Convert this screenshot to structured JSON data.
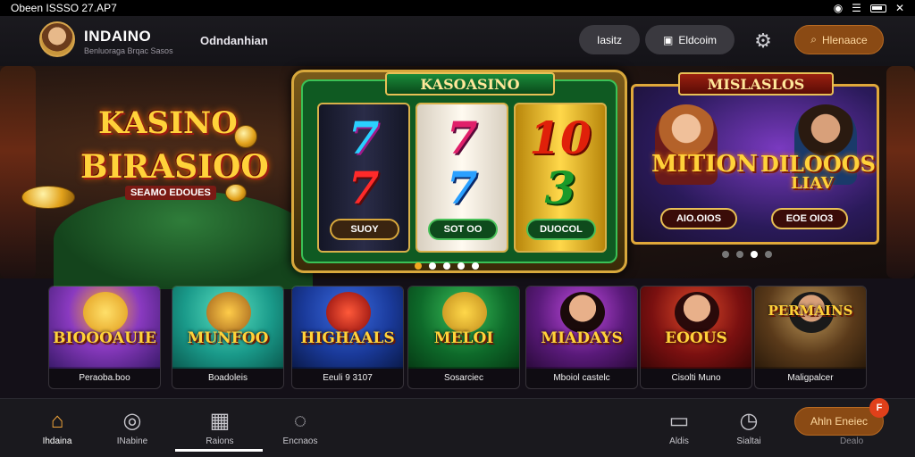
{
  "status_bar": {
    "time": "Obeen ISSSO 27.AP7"
  },
  "header": {
    "brand_title": "INDAINO",
    "brand_subtitle": "Benluoraga Brqac Sasos",
    "nav_link": "Odndanhian",
    "login_label": "Iasitz",
    "register_label": "Eldcoim",
    "search_label": "Hlenaace"
  },
  "banner": {
    "left_promo": {
      "line1": "KASINO",
      "line2": "BIRASIOO",
      "tag": "SEAMO EDOUES"
    },
    "slot": {
      "header": "KASOASINO",
      "reels": [
        {
          "top": "7",
          "bottom": "7",
          "button": "SUOY"
        },
        {
          "top": "7",
          "bottom": "7",
          "button": "SOT OO"
        },
        {
          "top": "10",
          "bottom": "3",
          "button": "DUOCOL"
        }
      ]
    },
    "right_promo": {
      "header": "MISLASLOS",
      "word1": "MITION",
      "word2": "DILOOOS",
      "word3": "LIAV",
      "button1": "AIO.OIOS",
      "button2": "EOE OIO3"
    }
  },
  "tiles": [
    {
      "title": "BIOOOAUIE",
      "label": "Peraoba.boo",
      "bg": "#6a2a9a"
    },
    {
      "title": "MUNFOO",
      "label": "Boadoleis",
      "bg": "#1a9a8a"
    },
    {
      "title": "HIGHAALS",
      "label": "Eeuli 9 3107",
      "bg": "#1a3a9a"
    },
    {
      "title": "MELOI",
      "label": "Sosarciec",
      "bg": "#0e6a2a"
    },
    {
      "title": "MIADAYS",
      "label": "Mboiol castelc",
      "bg": "#5a1a7a"
    },
    {
      "title": "EOOUS",
      "label": "Cisolti Muno",
      "bg": "#7a1010"
    },
    {
      "title": "PERMAINS",
      "label": "Maligpalcer",
      "bg": "#2a3a5a"
    }
  ],
  "bottom_nav": {
    "items": [
      {
        "label": "Ihdaina",
        "icon": "home-icon"
      },
      {
        "label": "INabine",
        "icon": "roulette-icon"
      },
      {
        "label": "Raions",
        "icon": "grid-icon"
      },
      {
        "label": "Encnaos",
        "icon": "chat-icon"
      },
      {
        "label": "Aldis",
        "icon": "tv-icon"
      },
      {
        "label": "Sialtai",
        "icon": "timer-icon"
      }
    ],
    "cta_label": "Ahln Eneiec",
    "cta_badge": "F",
    "cta_sub": "Dealo"
  },
  "colors": {
    "accent": "#f0a43a",
    "cta_bg": "#8a4a14",
    "active_dot": "#f0a820"
  }
}
